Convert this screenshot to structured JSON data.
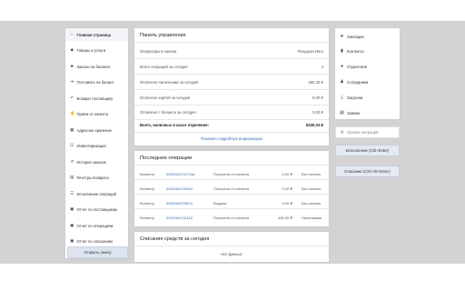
{
  "sidebar": {
    "items": [
      {
        "label": "Главная страница",
        "icon": "home-icon"
      },
      {
        "label": "Товары и услуги",
        "icon": "tags-icon"
      },
      {
        "label": "Заказы на балансе",
        "icon": "truck-icon"
      },
      {
        "label": "Поставить на баланс",
        "icon": "arrow-right-icon"
      },
      {
        "label": "Возврат поставщику",
        "icon": "arrow-left-icon"
      },
      {
        "label": "Приём от клиента",
        "icon": "hand-icon"
      },
      {
        "label": "Адресное хранение",
        "icon": "grid-icon"
      },
      {
        "label": "Инвентаризация",
        "icon": "checkbox-icon"
      },
      {
        "label": "История заказов",
        "icon": "history-icon"
      },
      {
        "label": "Реестры возврата",
        "icon": "registry-icon"
      },
      {
        "label": "Исполнение операций",
        "icon": "list-icon"
      },
      {
        "label": "Отчет по поставщикам",
        "icon": "calendar-icon"
      },
      {
        "label": "Отчет по операциям",
        "icon": "calendar-icon"
      },
      {
        "label": "Отчет по списаниям",
        "icon": "calendar-icon"
      }
    ],
    "open_shift_label": "Открыть смену"
  },
  "control_panel": {
    "title": "Панель управления",
    "rows": [
      {
        "label": "Операторы в панели",
        "value": "Рекуцкая Инга"
      },
      {
        "label": "Всего операций за сегодня",
        "value": "4"
      },
      {
        "label": "Оплачено наличными за сегодня",
        "value": "450,30 ₽"
      },
      {
        "label": "Оплачено картой за сегодня",
        "value": "0,00 ₽"
      },
      {
        "label": "Оплачено с баланса за сегодня",
        "value": "0,00 ₽"
      },
      {
        "label": "Итого, оплачено за сегодня",
        "value": "450,30 ₽"
      }
    ],
    "total": {
      "label": "Всего, наличных в кассе отделения:",
      "value": "8330,04 ₽"
    },
    "more_info_link": "Показать подробную информацию"
  },
  "recent_ops": {
    "title": "Последние операции",
    "rows": [
      {
        "source": "Boxberry",
        "number": "0000166716703a",
        "op": "Получена от клиента",
        "amount": "0,00 ₽",
        "payment": "Без оплаты"
      },
      {
        "source": "Boxberry",
        "number": "0000166745364",
        "op": "Получена от клиента",
        "amount": "0,00 ₽",
        "payment": "Без оплаты"
      },
      {
        "source": "Boxberry",
        "number": "0000166575813",
        "op": "Выдача",
        "amount": "0,00 ₽",
        "payment": "Без оплаты"
      },
      {
        "source": "Boxberry",
        "number": "0000166742316",
        "op": "Получена от клиента",
        "amount": "450,30 ₽",
        "payment": "Наличными"
      }
    ]
  },
  "write_offs": {
    "title": "Списания средств за сегодня",
    "empty": "Нет Данных"
  },
  "right_sidebar": {
    "items": [
      {
        "label": "Закладки",
        "icon": "star-icon"
      },
      {
        "label": "Контакты",
        "icon": "contacts-icon"
      },
      {
        "label": "Отделения",
        "icon": "map-marker-icon"
      },
      {
        "label": "Сотрудники",
        "icon": "user-icon"
      },
      {
        "label": "Загрузки",
        "icon": "download-icon"
      },
      {
        "label": "Заявки",
        "icon": "ticket-icon"
      }
    ],
    "search_placeholder": "Трекинг операций",
    "btn_exec": "Исполнение (Ctrl+Enter)",
    "btn_writeoff": "Списание (Ctrl+Alt+Enter)"
  }
}
